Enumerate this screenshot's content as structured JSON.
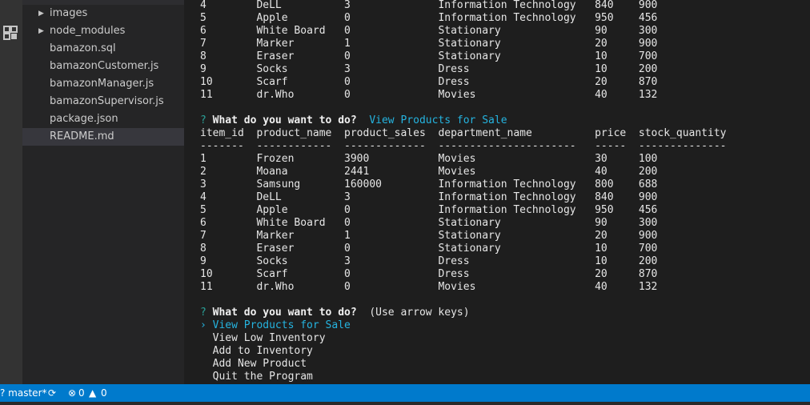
{
  "explorer": {
    "items": [
      {
        "label": "images",
        "folder": true
      },
      {
        "label": "node_modules",
        "folder": true
      },
      {
        "label": "bamazon.sql",
        "folder": false
      },
      {
        "label": "bamazonCustomer.js",
        "folder": false
      },
      {
        "label": "bamazonManager.js",
        "folder": false
      },
      {
        "label": "bamazonSupervisor.js",
        "folder": false
      },
      {
        "label": "package.json",
        "folder": false
      },
      {
        "label": "README.md",
        "folder": false,
        "selected": true
      }
    ]
  },
  "terminal": {
    "top_rows": [
      [
        "4",
        "DeLL",
        "3",
        "Information Technology",
        "840",
        "900"
      ],
      [
        "5",
        "Apple",
        "0",
        "Information Technology",
        "950",
        "456"
      ],
      [
        "6",
        "White Board",
        "0",
        "Stationary",
        "90",
        "300"
      ],
      [
        "7",
        "Marker",
        "1",
        "Stationary",
        "20",
        "900"
      ],
      [
        "8",
        "Eraser",
        "0",
        "Stationary",
        "10",
        "700"
      ],
      [
        "9",
        "Socks",
        "3",
        "Dress",
        "10",
        "200"
      ],
      [
        "10",
        "Scarf",
        "0",
        "Dress",
        "20",
        "870"
      ],
      [
        "11",
        "dr.Who",
        "0",
        "Movies",
        "40",
        "132"
      ]
    ],
    "prompt_symbol": "?",
    "question": "What do you want to do?",
    "answer": "View Products for Sale",
    "hint": "(Use arrow keys)",
    "headers": [
      "item_id",
      "product_name",
      "product_sales",
      "department_name",
      "price",
      "stock_quantity"
    ],
    "separators": [
      "-------",
      "------------",
      "-------------",
      "----------------------",
      "-----",
      "--------------"
    ],
    "rows": [
      [
        "1",
        "Frozen",
        "3900",
        "Movies",
        "30",
        "100"
      ],
      [
        "2",
        "Moana",
        "2441",
        "Movies",
        "40",
        "200"
      ],
      [
        "3",
        "Samsung",
        "160000",
        "Information Technology",
        "800",
        "688"
      ],
      [
        "4",
        "DeLL",
        "3",
        "Information Technology",
        "840",
        "900"
      ],
      [
        "5",
        "Apple",
        "0",
        "Information Technology",
        "950",
        "456"
      ],
      [
        "6",
        "White Board",
        "0",
        "Stationary",
        "90",
        "300"
      ],
      [
        "7",
        "Marker",
        "1",
        "Stationary",
        "20",
        "900"
      ],
      [
        "8",
        "Eraser",
        "0",
        "Stationary",
        "10",
        "700"
      ],
      [
        "9",
        "Socks",
        "3",
        "Dress",
        "10",
        "200"
      ],
      [
        "10",
        "Scarf",
        "0",
        "Dress",
        "20",
        "870"
      ],
      [
        "11",
        "dr.Who",
        "0",
        "Movies",
        "40",
        "132"
      ]
    ],
    "cursor_symbol": "›",
    "menu": [
      {
        "label": "View Products for Sale",
        "selected": true
      },
      {
        "label": "View Low Inventory"
      },
      {
        "label": "Add to Inventory"
      },
      {
        "label": "Add New Product"
      },
      {
        "label": "Quit the Program"
      }
    ]
  },
  "statusbar": {
    "branch": "? master*",
    "errors": "0",
    "warnings": "0"
  },
  "colors": {
    "statusbar": "#007acc",
    "prompt": "#2aa198",
    "answer": "#25b4e0"
  }
}
